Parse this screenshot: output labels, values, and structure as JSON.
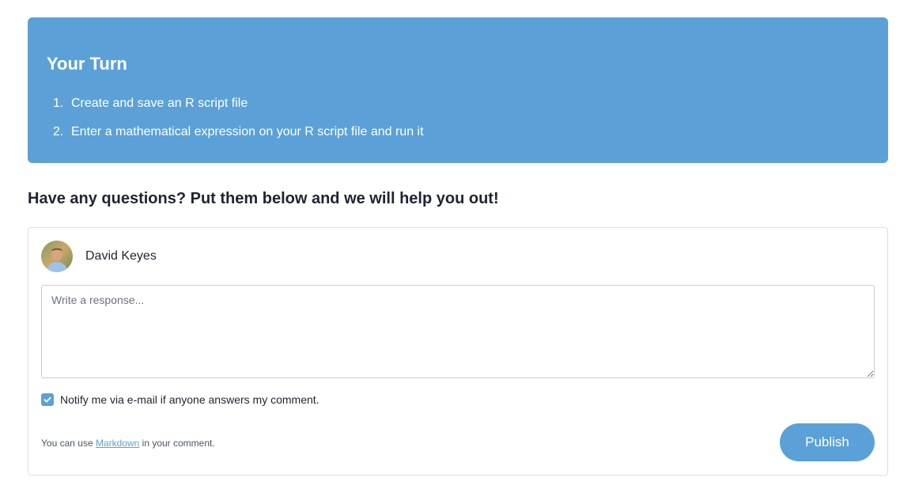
{
  "callout": {
    "title": "Your Turn",
    "items": [
      {
        "num": "1.",
        "text": "Create and save an R script file"
      },
      {
        "num": "2.",
        "text": "Enter a mathematical expression on your R script file and run it"
      }
    ]
  },
  "questions": {
    "heading": "Have any questions? Put them below and we will help you out!"
  },
  "comment": {
    "user_name": "David Keyes",
    "avatar_icon": "user-avatar-photo",
    "response_placeholder": "Write a response...",
    "response_value": "",
    "notify_checked": true,
    "notify_label": "Notify me via e-mail if anyone answers my comment.",
    "markdown_prefix": "You can use ",
    "markdown_link": "Markdown",
    "markdown_suffix": " in your comment.",
    "publish_label": "Publish"
  },
  "colors": {
    "accent": "#5ba1d7",
    "text": "#1f2430",
    "border": "#dcdfe4"
  }
}
